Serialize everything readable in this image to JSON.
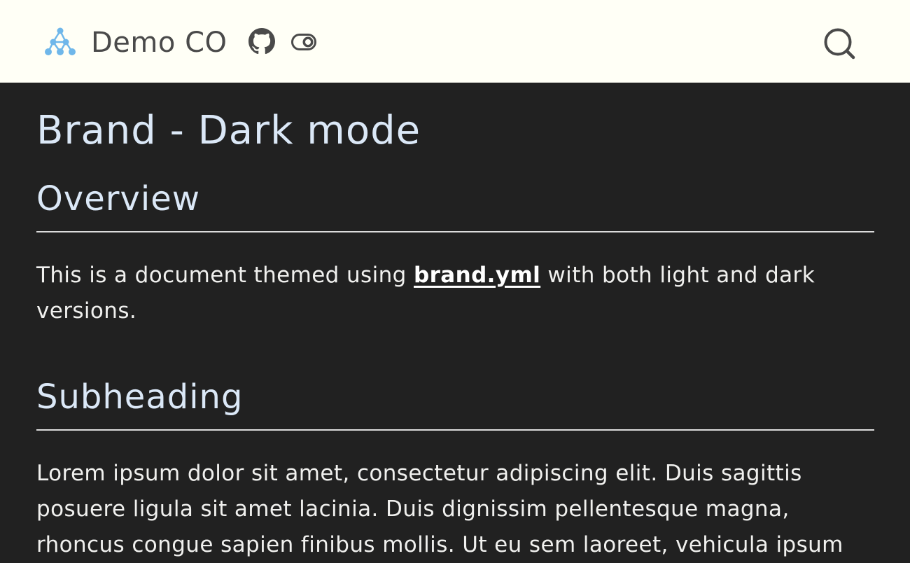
{
  "navbar": {
    "brand_name": "Demo CO",
    "logo_icon": "network-nodes-icon",
    "github_icon": "github-icon",
    "toggle_icon": "toggle-switch-icon",
    "search_icon": "search-icon",
    "background": "#fffff6",
    "logo_color": "#6fb7ea"
  },
  "page": {
    "title": "Brand - Dark mode",
    "background": "#212121",
    "sections": [
      {
        "heading": "Overview",
        "paragraph_before_link": "This is a document themed using ",
        "link_text": "brand.yml",
        "paragraph_after_link": " with both light and dark versions."
      },
      {
        "heading": "Subheading",
        "paragraph": "Lorem ipsum dolor sit amet, consectetur adipiscing elit. Duis sagittis posuere ligula sit amet lacinia. Duis dignissim pellentesque magna, rhoncus congue sapien finibus mollis. Ut eu sem laoreet, vehicula ipsum"
      }
    ]
  }
}
